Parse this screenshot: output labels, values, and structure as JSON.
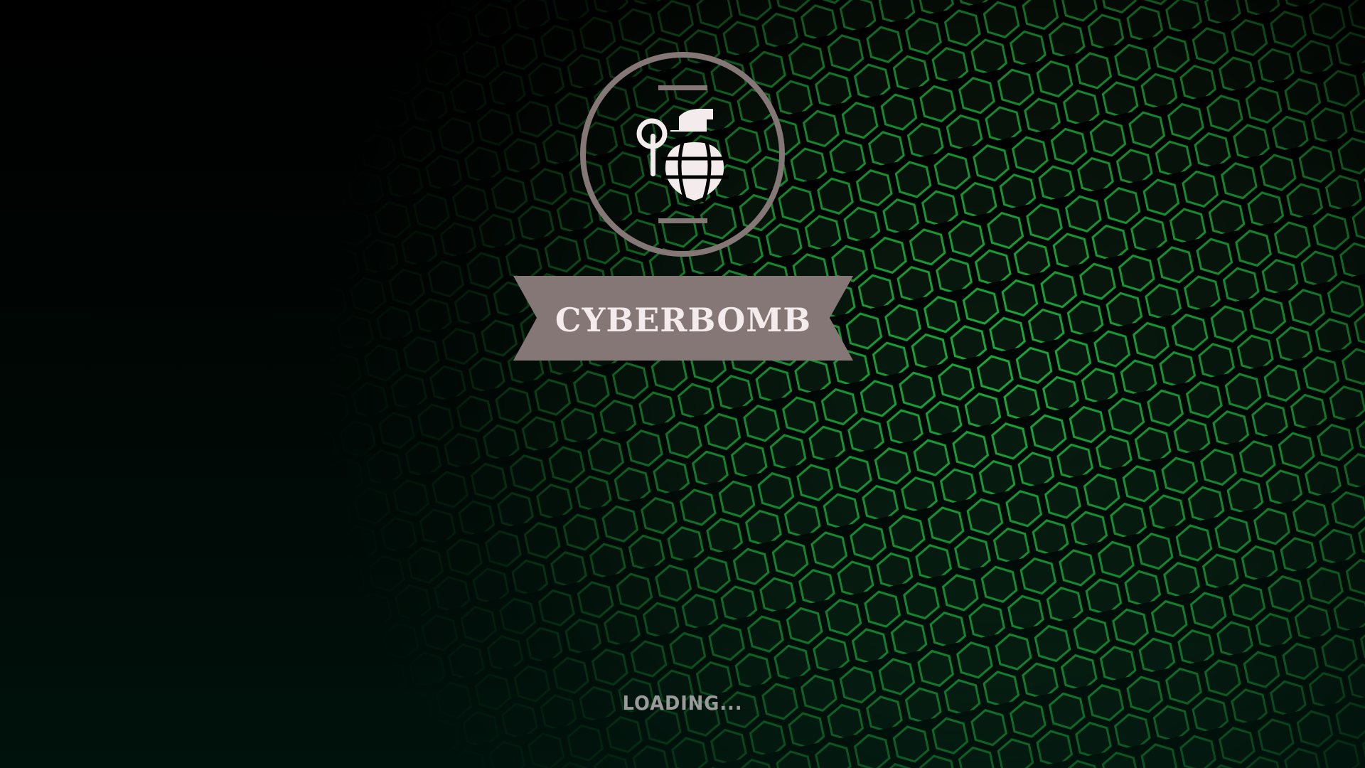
{
  "game": {
    "title": "CYBERBOMB",
    "loading_text": "LOADING...",
    "logo_icon": "grenade-icon"
  },
  "colors": {
    "background": "#000000",
    "hex_glow": "#1fd03a",
    "emblem": "#857776",
    "icon_fill": "#f4ecec",
    "loading_text": "#9a9a9a"
  }
}
